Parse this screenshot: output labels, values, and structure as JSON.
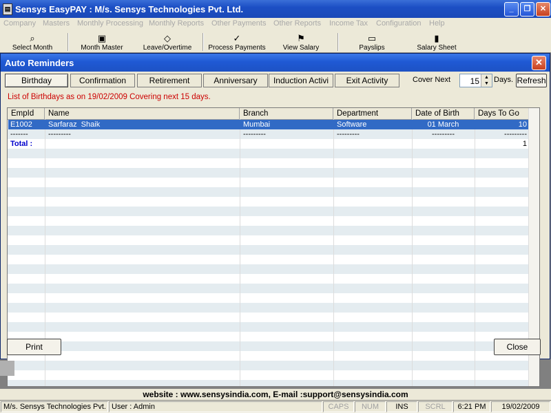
{
  "app": {
    "title": "Sensys EasyPAY : M/s. Sensys Technologies Pvt. Ltd.",
    "icon_glyph": "▤"
  },
  "menu": [
    "Company",
    "Masters",
    "Monthly Processing",
    "Monthly Reports",
    "Other Payments",
    "Other Reports",
    "Income Tax",
    "Configuration",
    "Help"
  ],
  "toolbar": [
    {
      "label": "Select Month",
      "icon": "magnifier-icon"
    },
    {
      "label": "Month Master",
      "icon": "calendar-icon"
    },
    {
      "label": "Leave/Overtime",
      "icon": "diamond-icon"
    },
    {
      "label": "Process Payments",
      "icon": "checkmark-icon"
    },
    {
      "label": "View Salary",
      "icon": "salary-icon"
    },
    {
      "label": "Payslips",
      "icon": "payslip-icon"
    },
    {
      "label": "Salary Sheet",
      "icon": "sheet-icon"
    }
  ],
  "dialog": {
    "title": "Auto Reminders",
    "tabs": [
      "Birthday",
      "Confirmation",
      "Retirement",
      "Anniversary",
      "Induction Activi",
      "Exit Activity"
    ],
    "active_tab": "Birthday",
    "cover_next_label": "Cover Next",
    "cover_next_value": "15",
    "days_label": "Days.",
    "refresh_label": "Refresh",
    "info_text": "List of Birthdays as on 19/02/2009 Covering next 15 days.",
    "columns": [
      "EmpId",
      "Name",
      "Branch",
      "Department",
      "Date of Birth",
      "Days To Go"
    ],
    "rows": [
      {
        "empid": "E1002",
        "name": "Sarfaraz  Shaik",
        "branch": "Mumbai",
        "department": "Software",
        "dob": "01 March",
        "days": "10"
      }
    ],
    "separator": {
      "empid": "-------",
      "name": "---------",
      "branch": "---------",
      "department": "---------",
      "dob": "---------",
      "days": "---------"
    },
    "total_label": "Total :",
    "total_value": "1",
    "print_label": "Print",
    "close_label": "Close"
  },
  "footer": {
    "website": "website : www.sensysindia.com, E-mail :support@sensysindia.com",
    "company": "M/s. Sensys Technologies Pvt.",
    "user": "User : Admin",
    "caps": "CAPS",
    "num": "NUM",
    "ins": "INS",
    "scrl": "SCRL",
    "time": "6:21 PM",
    "date": "19/02/2009"
  },
  "colors": {
    "titlebar": "#1c4fc4",
    "selection": "#316ac5",
    "info_text": "#cc0000",
    "total_text": "#0000cc"
  }
}
